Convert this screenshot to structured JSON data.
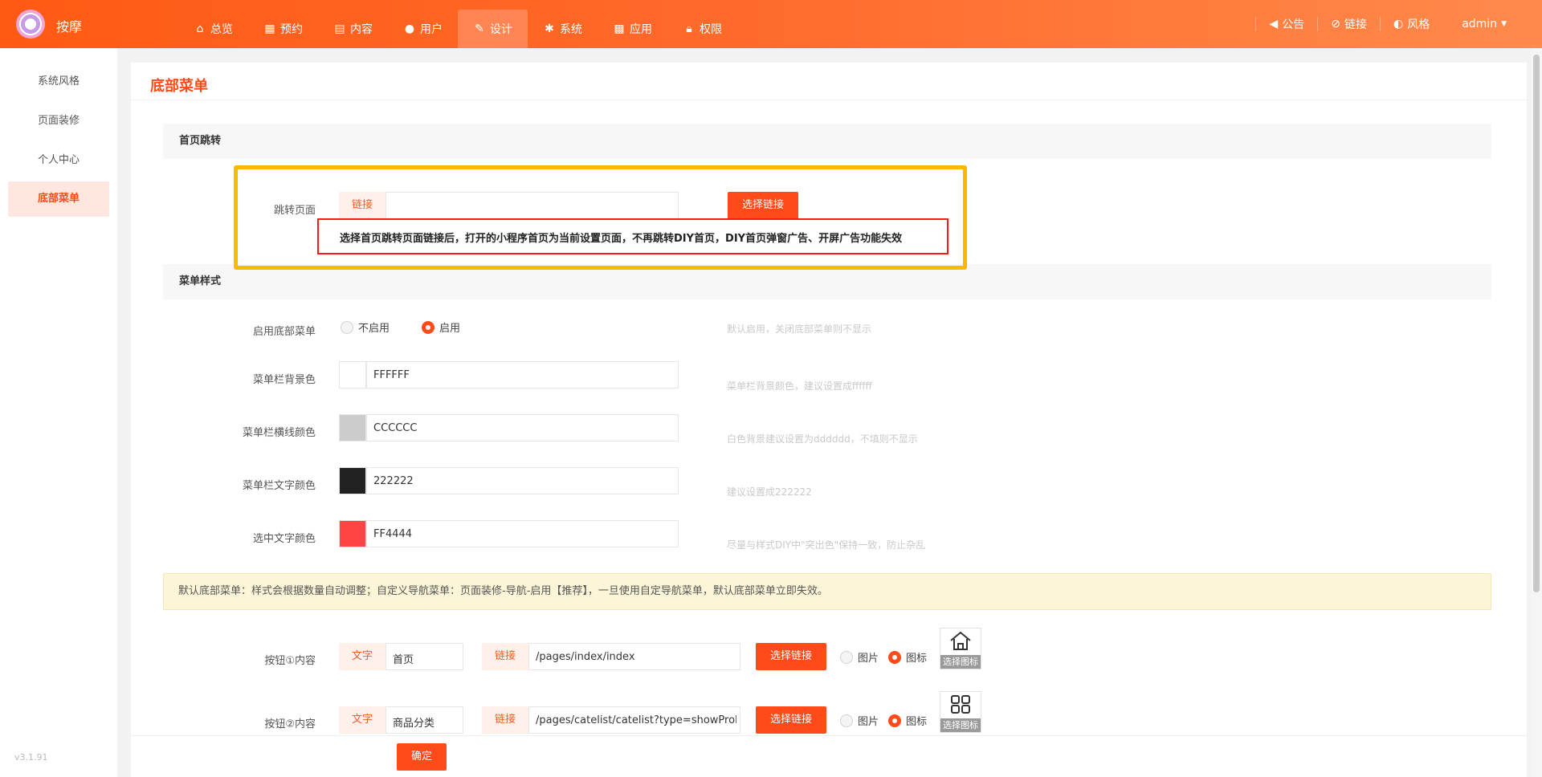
{
  "header": {
    "app_name": "按摩",
    "nav": [
      {
        "label": "总览",
        "icon": "home-icon"
      },
      {
        "label": "预约",
        "icon": "calendar-icon"
      },
      {
        "label": "内容",
        "icon": "document-icon"
      },
      {
        "label": "用户",
        "icon": "user-icon"
      },
      {
        "label": "设计",
        "icon": "brush-icon"
      },
      {
        "label": "系统",
        "icon": "gear-icon"
      },
      {
        "label": "应用",
        "icon": "grid-icon"
      },
      {
        "label": "权限",
        "icon": "lock-icon"
      }
    ],
    "active_nav": "设计",
    "right": {
      "announce": "公告",
      "link": "链接",
      "style": "风格",
      "user": "admin"
    }
  },
  "sidebar": {
    "items": [
      "系统风格",
      "页面装修",
      "个人中心",
      "底部菜单"
    ],
    "active": "底部菜单",
    "version": "v3.1.91"
  },
  "main": {
    "title": "底部菜单",
    "section_jump": "首页跳转",
    "jump_label": "跳转页面",
    "link_prefix": "链接",
    "jump_value": "",
    "choose_link": "选择链接",
    "jump_note": "选择首页跳转页面链接后，打开的小程序首页为当前设置页面，不再跳转DIY首页，DIY首页弹窗广告、开屏广告功能失效",
    "section_style": "菜单样式",
    "enable_label": "启用底部菜单",
    "enable_options": [
      "不启用",
      "启用"
    ],
    "enable_selected": "启用",
    "enable_hint": "默认启用，关闭底部菜单则不显示",
    "bg_label": "菜单栏背景色",
    "bg_value": "FFFFFF",
    "bg_hint": "菜单栏背景颜色，建议设置成ffffff",
    "line_label": "菜单栏横线颜色",
    "line_value": "CCCCCC",
    "line_hint": "白色背景建议设置为dddddd，不填则不显示",
    "text_label": "菜单栏文字颜色",
    "text_value": "222222",
    "text_hint": "建议设置成222222",
    "selected_label": "选中文字颜色",
    "selected_value": "FF4444",
    "selected_hint": "尽量与样式DIY中\"突出色\"保持一致，防止杂乱",
    "notice": "默认底部菜单：样式会根据数量自动调整；自定义导航菜单：页面装修-导航-启用【推荐】，一旦使用自定导航菜单，默认底部菜单立即失效。",
    "buttons": [
      {
        "label": "按钮①内容",
        "text_prefix": "文字",
        "text": "首页",
        "link_prefix": "链接",
        "link": "/pages/index/index",
        "choose": "选择链接",
        "opt_image": "图片",
        "opt_icon": "图标",
        "selected": "图标",
        "icon": "home-outline-icon",
        "icon_caption": "选择图标"
      },
      {
        "label": "按钮②内容",
        "text_prefix": "文字",
        "text": "商品分类",
        "link_prefix": "链接",
        "link": "/pages/catelist/catelist?type=showProM",
        "choose": "选择链接",
        "opt_image": "图片",
        "opt_icon": "图标",
        "selected": "图标",
        "icon": "category-grid-icon",
        "icon_caption": "选择图标"
      }
    ],
    "confirm": "确定"
  },
  "colors": {
    "accent": "#ff4a1a",
    "swatch_bg": "#FFFFFF",
    "swatch_line": "#CCCCCC",
    "swatch_text": "#222222",
    "swatch_selected": "#FF4444"
  }
}
